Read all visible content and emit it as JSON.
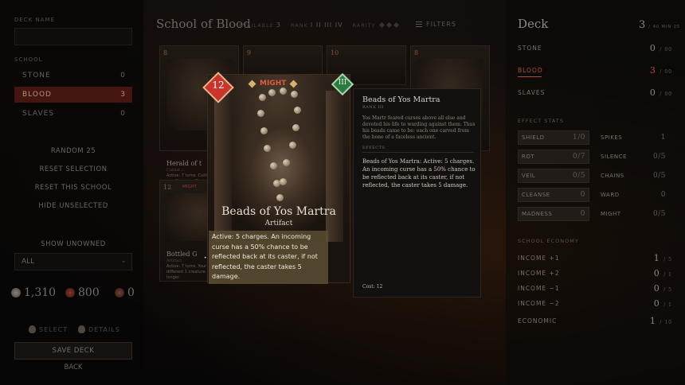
{
  "left": {
    "deck_name_label": "DECK NAME",
    "deck_name_value": "",
    "school_label": "SCHOOL",
    "schools": [
      {
        "name": "STONE",
        "count": "0"
      },
      {
        "name": "BLOOD",
        "count": "3"
      },
      {
        "name": "SLAVES",
        "count": "0"
      }
    ],
    "actions": [
      "RANDOM 25",
      "RESET SELECTION",
      "RESET THIS SCHOOL",
      "HIDE UNSELECTED"
    ],
    "show_unowned_label": "SHOW UNOWNED",
    "show_unowned_value": "ALL",
    "currencies": [
      "1,310",
      "800",
      "0"
    ],
    "hint_select": "SELECT",
    "hint_details": "DETAILS",
    "save_label": "SAVE DECK",
    "back_label": "BACK"
  },
  "top": {
    "school_title": "School of Blood",
    "available_label": "AVAILABLE",
    "available_count": "3",
    "rank_label": "RANK",
    "ranks": "I II III IV",
    "rarity_label": "RARITY",
    "filters_label": "FILTERS"
  },
  "grid": {
    "card1": {
      "cost": "8",
      "name": "Herald of t",
      "sub": "Cultist ...",
      "desc": "Active: 7 turns. Cultists move to sacrifices in, affects. Every 3 turns your gravity. 5 items and your tower by 5"
    },
    "card2": {
      "cost": "9"
    },
    "card3": {
      "cost": "10"
    },
    "card4": {
      "cost": "8"
    },
    "card5": {
      "cost": "12",
      "name": "Bottled G",
      "sub": "Artifact",
      "desc": "Active: 7 turns. Your sp. Kill a different 1 creature. tasks longer.",
      "tag": "MIGHT"
    }
  },
  "card": {
    "cost": "12",
    "school": "MIGHT",
    "rank": "III",
    "name": "Beads of Yos Martra",
    "type": "Artifact",
    "text": "Active: 5 charges. An incoming curse has a 50% chance to be reflected back at its caster, if not reflected, the caster takes 5 damage."
  },
  "tooltip": {
    "name": "Beads of Yos Martra",
    "rank": "RANK III",
    "flavor": "Yos Martr feared curses above all else and devoted his life to warding against them. Thus his beads came to be: each one carved from the bone of a faceless ancient.",
    "effects_label": "EFFECTS",
    "effect": "Beads of Yos Martra: Active: 5 charges. An incoming curse has a 50% chance to be reflected back at its caster, if not reflected, the caster takes 5 damage.",
    "cost": "Cost: 12"
  },
  "right": {
    "title": "Deck",
    "count": "3",
    "count_suffix": "/ 40 MIN 25",
    "schools": [
      {
        "name": "STONE",
        "value": "0",
        "suffix": "/ 00"
      },
      {
        "name": "BLOOD",
        "value": "3",
        "suffix": "/ 00"
      },
      {
        "name": "SLAVES",
        "value": "0",
        "suffix": "/ 00"
      }
    ],
    "effects_label": "EFFECT STATS",
    "effects": [
      {
        "name": "SHIELD",
        "value": "1/0"
      },
      {
        "name": "SPIKES",
        "value": "1"
      },
      {
        "name": "ROT",
        "value": "0/7"
      },
      {
        "name": "SILENCE",
        "value": "0/5"
      },
      {
        "name": "VEIL",
        "value": "0/5"
      },
      {
        "name": "CHAINS",
        "value": "0/5"
      },
      {
        "name": "CLEANSE",
        "value": "0"
      },
      {
        "name": "WARD",
        "value": "0"
      },
      {
        "name": "MADNESS",
        "value": "0"
      },
      {
        "name": "MIGHT",
        "value": "0/5"
      }
    ],
    "economy_label": "SCHOOL ECONOMY",
    "economy": [
      {
        "name": "INCOME +1",
        "value": "1",
        "suffix": "/ 5"
      },
      {
        "name": "INCOME +2",
        "value": "0",
        "suffix": "/ 1"
      },
      {
        "name": "INCOME −1",
        "value": "0",
        "suffix": "/ 5"
      },
      {
        "name": "INCOME −2",
        "value": "0",
        "suffix": "/ 1"
      },
      {
        "name": "ECONOMIC",
        "value": "1",
        "suffix": "/ 10"
      }
    ]
  }
}
